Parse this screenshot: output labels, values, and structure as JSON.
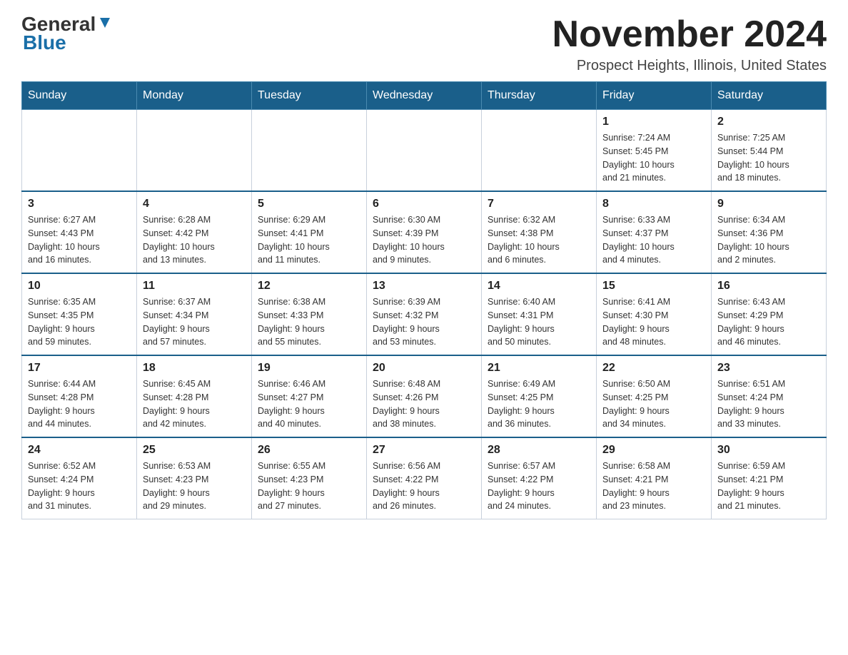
{
  "logo": {
    "general": "General",
    "blue": "Blue"
  },
  "title": "November 2024",
  "location": "Prospect Heights, Illinois, United States",
  "weekdays": [
    "Sunday",
    "Monday",
    "Tuesday",
    "Wednesday",
    "Thursday",
    "Friday",
    "Saturday"
  ],
  "weeks": [
    [
      {
        "day": "",
        "info": ""
      },
      {
        "day": "",
        "info": ""
      },
      {
        "day": "",
        "info": ""
      },
      {
        "day": "",
        "info": ""
      },
      {
        "day": "",
        "info": ""
      },
      {
        "day": "1",
        "info": "Sunrise: 7:24 AM\nSunset: 5:45 PM\nDaylight: 10 hours\nand 21 minutes."
      },
      {
        "day": "2",
        "info": "Sunrise: 7:25 AM\nSunset: 5:44 PM\nDaylight: 10 hours\nand 18 minutes."
      }
    ],
    [
      {
        "day": "3",
        "info": "Sunrise: 6:27 AM\nSunset: 4:43 PM\nDaylight: 10 hours\nand 16 minutes."
      },
      {
        "day": "4",
        "info": "Sunrise: 6:28 AM\nSunset: 4:42 PM\nDaylight: 10 hours\nand 13 minutes."
      },
      {
        "day": "5",
        "info": "Sunrise: 6:29 AM\nSunset: 4:41 PM\nDaylight: 10 hours\nand 11 minutes."
      },
      {
        "day": "6",
        "info": "Sunrise: 6:30 AM\nSunset: 4:39 PM\nDaylight: 10 hours\nand 9 minutes."
      },
      {
        "day": "7",
        "info": "Sunrise: 6:32 AM\nSunset: 4:38 PM\nDaylight: 10 hours\nand 6 minutes."
      },
      {
        "day": "8",
        "info": "Sunrise: 6:33 AM\nSunset: 4:37 PM\nDaylight: 10 hours\nand 4 minutes."
      },
      {
        "day": "9",
        "info": "Sunrise: 6:34 AM\nSunset: 4:36 PM\nDaylight: 10 hours\nand 2 minutes."
      }
    ],
    [
      {
        "day": "10",
        "info": "Sunrise: 6:35 AM\nSunset: 4:35 PM\nDaylight: 9 hours\nand 59 minutes."
      },
      {
        "day": "11",
        "info": "Sunrise: 6:37 AM\nSunset: 4:34 PM\nDaylight: 9 hours\nand 57 minutes."
      },
      {
        "day": "12",
        "info": "Sunrise: 6:38 AM\nSunset: 4:33 PM\nDaylight: 9 hours\nand 55 minutes."
      },
      {
        "day": "13",
        "info": "Sunrise: 6:39 AM\nSunset: 4:32 PM\nDaylight: 9 hours\nand 53 minutes."
      },
      {
        "day": "14",
        "info": "Sunrise: 6:40 AM\nSunset: 4:31 PM\nDaylight: 9 hours\nand 50 minutes."
      },
      {
        "day": "15",
        "info": "Sunrise: 6:41 AM\nSunset: 4:30 PM\nDaylight: 9 hours\nand 48 minutes."
      },
      {
        "day": "16",
        "info": "Sunrise: 6:43 AM\nSunset: 4:29 PM\nDaylight: 9 hours\nand 46 minutes."
      }
    ],
    [
      {
        "day": "17",
        "info": "Sunrise: 6:44 AM\nSunset: 4:28 PM\nDaylight: 9 hours\nand 44 minutes."
      },
      {
        "day": "18",
        "info": "Sunrise: 6:45 AM\nSunset: 4:28 PM\nDaylight: 9 hours\nand 42 minutes."
      },
      {
        "day": "19",
        "info": "Sunrise: 6:46 AM\nSunset: 4:27 PM\nDaylight: 9 hours\nand 40 minutes."
      },
      {
        "day": "20",
        "info": "Sunrise: 6:48 AM\nSunset: 4:26 PM\nDaylight: 9 hours\nand 38 minutes."
      },
      {
        "day": "21",
        "info": "Sunrise: 6:49 AM\nSunset: 4:25 PM\nDaylight: 9 hours\nand 36 minutes."
      },
      {
        "day": "22",
        "info": "Sunrise: 6:50 AM\nSunset: 4:25 PM\nDaylight: 9 hours\nand 34 minutes."
      },
      {
        "day": "23",
        "info": "Sunrise: 6:51 AM\nSunset: 4:24 PM\nDaylight: 9 hours\nand 33 minutes."
      }
    ],
    [
      {
        "day": "24",
        "info": "Sunrise: 6:52 AM\nSunset: 4:24 PM\nDaylight: 9 hours\nand 31 minutes."
      },
      {
        "day": "25",
        "info": "Sunrise: 6:53 AM\nSunset: 4:23 PM\nDaylight: 9 hours\nand 29 minutes."
      },
      {
        "day": "26",
        "info": "Sunrise: 6:55 AM\nSunset: 4:23 PM\nDaylight: 9 hours\nand 27 minutes."
      },
      {
        "day": "27",
        "info": "Sunrise: 6:56 AM\nSunset: 4:22 PM\nDaylight: 9 hours\nand 26 minutes."
      },
      {
        "day": "28",
        "info": "Sunrise: 6:57 AM\nSunset: 4:22 PM\nDaylight: 9 hours\nand 24 minutes."
      },
      {
        "day": "29",
        "info": "Sunrise: 6:58 AM\nSunset: 4:21 PM\nDaylight: 9 hours\nand 23 minutes."
      },
      {
        "day": "30",
        "info": "Sunrise: 6:59 AM\nSunset: 4:21 PM\nDaylight: 9 hours\nand 21 minutes."
      }
    ]
  ]
}
